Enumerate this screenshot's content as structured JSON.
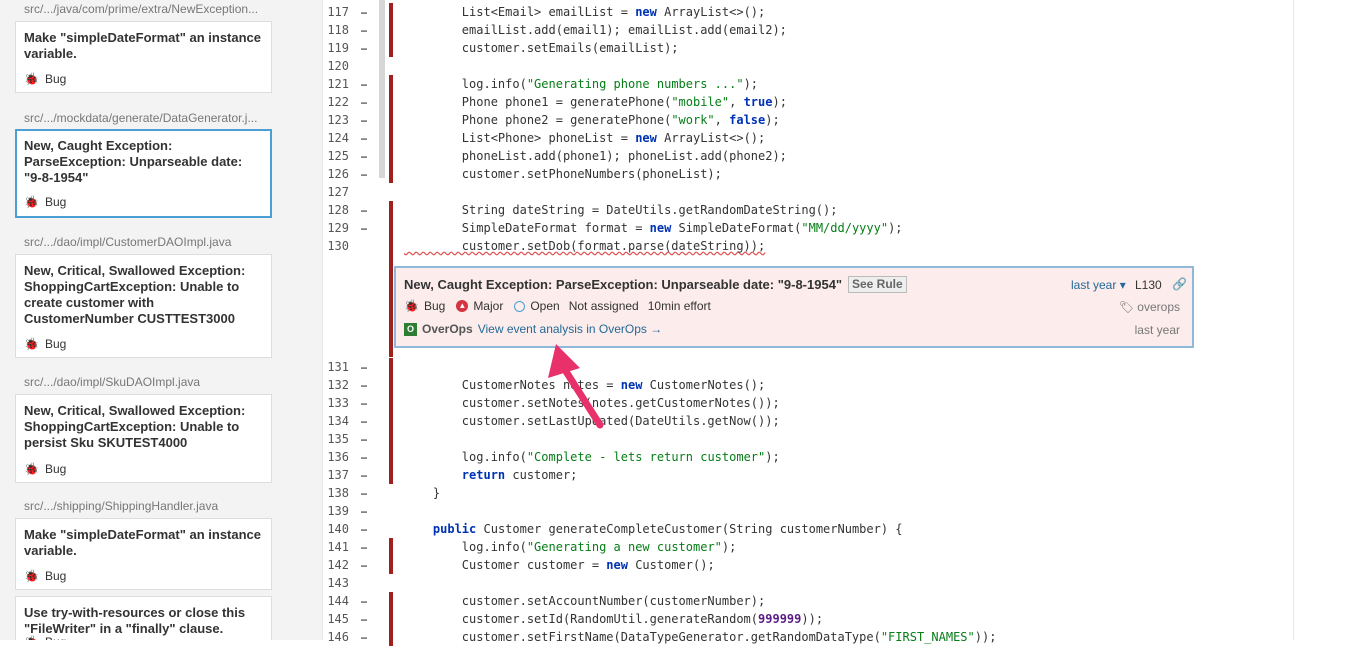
{
  "sidebar": {
    "groups": [
      {
        "path": "src/.../java/com/prime/extra/NewException...",
        "issues": [
          {
            "title": "Make \"simpleDateFormat\" an instance variable.",
            "type": "Bug"
          }
        ]
      },
      {
        "path": "src/.../mockdata/generate/DataGenerator.j...",
        "issues": [
          {
            "title": "New, Caught Exception: ParseException: Unparseable date: \"9-8-1954\"",
            "type": "Bug",
            "selected": true
          }
        ]
      },
      {
        "path": "src/.../dao/impl/CustomerDAOImpl.java",
        "issues": [
          {
            "title": "New, Critical, Swallowed Exception: ShoppingCartException: Unable to create customer with CustomerNumber CUSTTEST3000",
            "type": "Bug"
          }
        ]
      },
      {
        "path": "src/.../dao/impl/SkuDAOImpl.java",
        "issues": [
          {
            "title": "New, Critical, Swallowed Exception: ShoppingCartException: Unable to persist Sku SKUTEST4000",
            "type": "Bug"
          }
        ]
      },
      {
        "path": "src/.../shipping/ShippingHandler.java",
        "issues": [
          {
            "title": "Make \"simpleDateFormat\" an instance variable.",
            "type": "Bug"
          },
          {
            "title": "Use try-with-resources or close this \"FileWriter\" in a \"finally\" clause.",
            "type": "Bug"
          }
        ]
      }
    ]
  },
  "code": {
    "lines_before": [
      {
        "num": "117",
        "dots": "…",
        "changed": true,
        "tokens": [
          [
            "",
            "        List<Email> emailList = "
          ],
          [
            "kw",
            "new"
          ],
          [
            "",
            " ArrayList<>();"
          ]
        ]
      },
      {
        "num": "118",
        "dots": "…",
        "changed": true,
        "tokens": [
          [
            "",
            "        emailList.add(email1); emailList.add(email2);"
          ]
        ]
      },
      {
        "num": "119",
        "dots": "…",
        "changed": true,
        "tokens": [
          [
            "",
            "        customer.setEmails(emailList);"
          ]
        ]
      },
      {
        "num": "120",
        "dots": "",
        "changed": false,
        "tokens": [
          [
            "",
            ""
          ]
        ]
      },
      {
        "num": "121",
        "dots": "…",
        "changed": true,
        "tokens": [
          [
            "",
            "        log.info("
          ],
          [
            "str",
            "\"Generating phone numbers ...\""
          ],
          [
            "",
            ");"
          ]
        ]
      },
      {
        "num": "122",
        "dots": "…",
        "changed": true,
        "tokens": [
          [
            "",
            "        Phone phone1 = generatePhone("
          ],
          [
            "str",
            "\"mobile\""
          ],
          [
            "",
            ", "
          ],
          [
            "kw",
            "true"
          ],
          [
            "",
            ");"
          ]
        ]
      },
      {
        "num": "123",
        "dots": "…",
        "changed": true,
        "tokens": [
          [
            "",
            "        Phone phone2 = generatePhone("
          ],
          [
            "str",
            "\"work\""
          ],
          [
            "",
            ", "
          ],
          [
            "kw",
            "false"
          ],
          [
            "",
            ");"
          ]
        ]
      },
      {
        "num": "124",
        "dots": "…",
        "changed": true,
        "tokens": [
          [
            "",
            "        List<Phone> phoneList = "
          ],
          [
            "kw",
            "new"
          ],
          [
            "",
            " ArrayList<>();"
          ]
        ]
      },
      {
        "num": "125",
        "dots": "…",
        "changed": true,
        "tokens": [
          [
            "",
            "        phoneList.add(phone1); phoneList.add(phone2);"
          ]
        ]
      },
      {
        "num": "126",
        "dots": "…",
        "changed": true,
        "tokens": [
          [
            "",
            "        customer.setPhoneNumbers(phoneList);"
          ]
        ]
      },
      {
        "num": "127",
        "dots": "",
        "changed": false,
        "tokens": [
          [
            "",
            ""
          ]
        ]
      },
      {
        "num": "128",
        "dots": "…",
        "changed": true,
        "tokens": [
          [
            "",
            "        String dateString = DateUtils.getRandomDateString();"
          ]
        ]
      },
      {
        "num": "129",
        "dots": "…",
        "changed": true,
        "tokens": [
          [
            "",
            "        SimpleDateFormat format = "
          ],
          [
            "kw",
            "new"
          ],
          [
            "",
            " SimpleDateFormat("
          ],
          [
            "str",
            "\"MM/dd/yyyy\""
          ],
          [
            "",
            ");"
          ]
        ]
      },
      {
        "num": "130",
        "dots": "",
        "changed": true,
        "squiggle": true,
        "tokens": [
          [
            "",
            "        customer.setDob(format.parse(dateString));"
          ]
        ]
      }
    ],
    "lines_after": [
      {
        "num": "131",
        "dots": "…",
        "changed": true,
        "tokens": [
          [
            "",
            ""
          ]
        ]
      },
      {
        "num": "132",
        "dots": "…",
        "changed": true,
        "tokens": [
          [
            "",
            "        CustomerNotes notes = "
          ],
          [
            "kw",
            "new"
          ],
          [
            "",
            " CustomerNotes();"
          ]
        ]
      },
      {
        "num": "133",
        "dots": "…",
        "changed": true,
        "tokens": [
          [
            "",
            "        customer.setNotes(notes.getCustomerNotes());"
          ]
        ]
      },
      {
        "num": "134",
        "dots": "…",
        "changed": true,
        "tokens": [
          [
            "",
            "        customer.setLastUpdated(DateUtils.getNow());"
          ]
        ]
      },
      {
        "num": "135",
        "dots": "…",
        "changed": true,
        "tokens": [
          [
            "",
            ""
          ]
        ]
      },
      {
        "num": "136",
        "dots": "…",
        "changed": true,
        "tokens": [
          [
            "",
            "        log.info("
          ],
          [
            "str",
            "\"Complete - lets return customer\""
          ],
          [
            "",
            ");"
          ]
        ]
      },
      {
        "num": "137",
        "dots": "…",
        "changed": true,
        "tokens": [
          [
            "",
            "        "
          ],
          [
            "kw",
            "return"
          ],
          [
            "",
            " customer;"
          ]
        ]
      },
      {
        "num": "138",
        "dots": "…",
        "changed": false,
        "tokens": [
          [
            "",
            "    }"
          ]
        ]
      },
      {
        "num": "139",
        "dots": "…",
        "changed": false,
        "tokens": [
          [
            "",
            ""
          ]
        ]
      },
      {
        "num": "140",
        "dots": "…",
        "changed": false,
        "tokens": [
          [
            "",
            "    "
          ],
          [
            "kw",
            "public"
          ],
          [
            "",
            " Customer generateCompleteCustomer(String customerNumber) {"
          ]
        ]
      },
      {
        "num": "141",
        "dots": "…",
        "changed": true,
        "tokens": [
          [
            "",
            "        log.info("
          ],
          [
            "str",
            "\"Generating a new customer\""
          ],
          [
            "",
            ");"
          ]
        ]
      },
      {
        "num": "142",
        "dots": "…",
        "changed": true,
        "tokens": [
          [
            "",
            "        Customer customer = "
          ],
          [
            "kw",
            "new"
          ],
          [
            "",
            " Customer();"
          ]
        ]
      },
      {
        "num": "143",
        "dots": "",
        "changed": false,
        "tokens": [
          [
            "",
            ""
          ]
        ]
      },
      {
        "num": "144",
        "dots": "…",
        "changed": true,
        "tokens": [
          [
            "",
            "        customer.setAccountNumber(customerNumber);"
          ]
        ]
      },
      {
        "num": "145",
        "dots": "…",
        "changed": true,
        "tokens": [
          [
            "",
            "        customer.setId(RandomUtil.generateRandom("
          ],
          [
            "num",
            "999999"
          ],
          [
            "",
            "));"
          ]
        ]
      },
      {
        "num": "146",
        "dots": "…",
        "changed": true,
        "tokens": [
          [
            "",
            "        customer.setFirstName(DataTypeGenerator.getRandomDataType("
          ],
          [
            "str",
            "\"FIRST_NAMES\""
          ],
          [
            "",
            "));"
          ]
        ]
      }
    ]
  },
  "issue": {
    "title": "New, Caught Exception: ParseException: Unparseable date: \"9-8-1954\"",
    "see_rule": "See Rule",
    "when": "last year",
    "line_ref": "L130",
    "type": "Bug",
    "severity": "Major",
    "status": "Open",
    "assignee": "Not assigned",
    "effort": "10min effort",
    "tags": "overops",
    "overops_name": "OverOps",
    "overops_link": "View event analysis in OverOps →",
    "updated": "last year"
  },
  "icons": {
    "bug": "bug-icon",
    "severity": "major-severity-icon",
    "status": "open-status-icon",
    "tag": "tag-icon",
    "permalink": "link-icon",
    "overops": "overops-logo"
  },
  "colors": {
    "issue_bg": "#fcecec",
    "issue_border": "#8fb8d9",
    "scm_changed": "#a01f1f",
    "selected_border": "#4b9fd5",
    "arrow": "#e8306a"
  }
}
